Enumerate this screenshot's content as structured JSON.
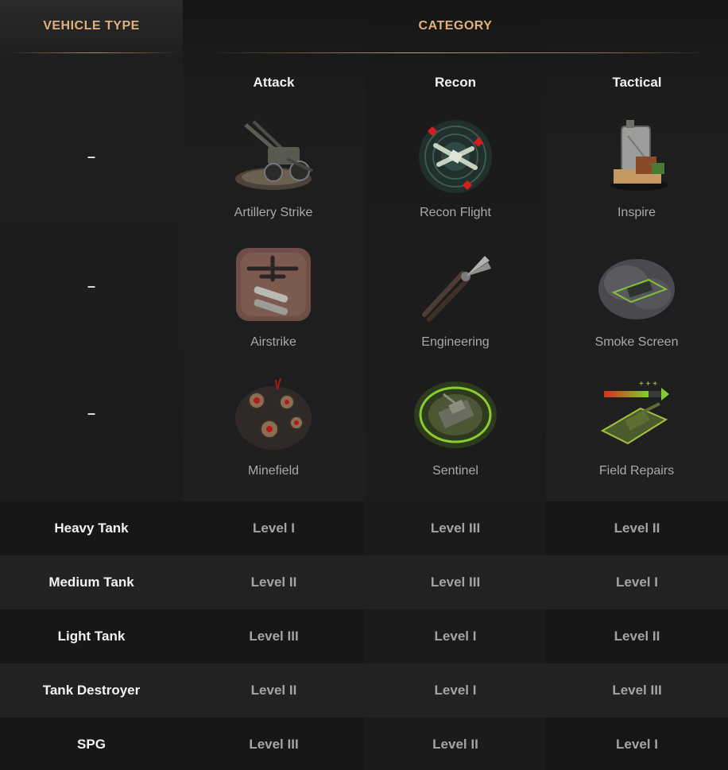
{
  "header": {
    "vehicle_type": "VEHICLE TYPE",
    "category": "CATEGORY"
  },
  "categories": [
    "Attack",
    "Recon",
    "Tactical"
  ],
  "consumable_rows": [
    {
      "vehicle_type": "–",
      "items": [
        {
          "name": "Artillery Strike",
          "icon": "artillery-icon"
        },
        {
          "name": "Recon Flight",
          "icon": "recon-plane-icon"
        },
        {
          "name": "Inspire",
          "icon": "supplies-icon"
        }
      ]
    },
    {
      "vehicle_type": "–",
      "items": [
        {
          "name": "Airstrike",
          "icon": "bomber-icon"
        },
        {
          "name": "Engineering",
          "icon": "pliers-icon"
        },
        {
          "name": "Smoke Screen",
          "icon": "smoke-icon"
        }
      ]
    },
    {
      "vehicle_type": "–",
      "items": [
        {
          "name": "Minefield",
          "icon": "mines-icon"
        },
        {
          "name": "Sentinel",
          "icon": "radar-tank-icon"
        },
        {
          "name": "Field Repairs",
          "icon": "repair-tank-icon"
        }
      ]
    }
  ],
  "level_rows": [
    {
      "vehicle": "Heavy Tank",
      "attack": "Level I",
      "recon": "Level III",
      "tactical": "Level II"
    },
    {
      "vehicle": "Medium Tank",
      "attack": "Level II",
      "recon": "Level III",
      "tactical": "Level I"
    },
    {
      "vehicle": "Light Tank",
      "attack": "Level III",
      "recon": "Level I",
      "tactical": "Level II"
    },
    {
      "vehicle": "Tank Destroyer",
      "attack": "Level II",
      "recon": "Level I",
      "tactical": "Level III"
    },
    {
      "vehicle": "SPG",
      "attack": "Level III",
      "recon": "Level II",
      "tactical": "Level I"
    }
  ],
  "colors": {
    "header_gold": "#e0b27a",
    "background": "#1b1b1c",
    "text_muted": "#a4a4a4"
  }
}
